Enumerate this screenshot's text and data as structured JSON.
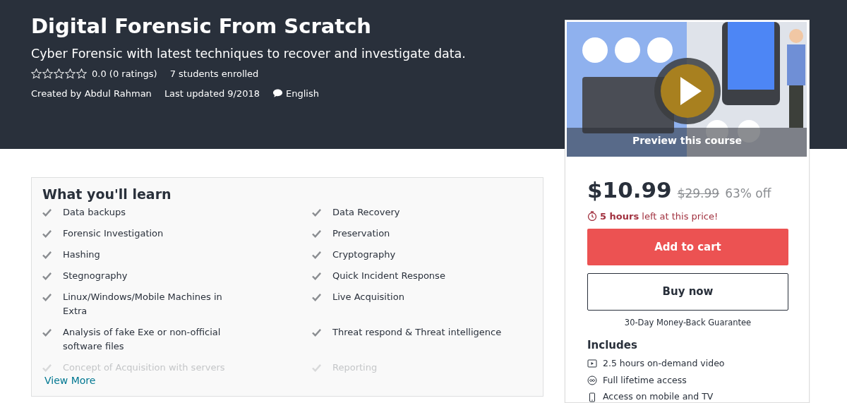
{
  "header": {
    "title": "Digital Forensic From Scratch",
    "subtitle": "Cyber Forensic with latest techniques to recover and investigate data.",
    "stars": 0,
    "rating": "0.0 (0 ratings)",
    "enrolled": "7 students enrolled",
    "author": "Created by Abdul Rahman",
    "updated": "Last updated 9/2018",
    "language": "English"
  },
  "learn": {
    "title": "What you'll learn",
    "items": [
      {
        "text": "Data backups",
        "faded": false
      },
      {
        "text": "Data Recovery",
        "faded": false
      },
      {
        "text": "Forensic Investigation",
        "faded": false
      },
      {
        "text": "Preservation",
        "faded": false
      },
      {
        "text": "Hashing",
        "faded": false
      },
      {
        "text": "Cryptography",
        "faded": false
      },
      {
        "text": "Stegnography",
        "faded": false
      },
      {
        "text": "Quick Incident Response",
        "faded": false
      },
      {
        "text": "Linux/Windows/Mobile Machines in Extra",
        "faded": false
      },
      {
        "text": "Live Acquisition",
        "faded": false
      },
      {
        "text": "Analysis of fake Exe or non-official software files",
        "faded": false
      },
      {
        "text": "Threat respond & Threat intelligence",
        "faded": false
      },
      {
        "text": "Concept of Acquisition with servers",
        "faded": true
      },
      {
        "text": "Reporting",
        "faded": true
      }
    ],
    "more_link": "View More"
  },
  "sidebar": {
    "preview_label": "Preview this course",
    "price": "$10.99",
    "original_price": "$29.99",
    "discount": "63% off",
    "timer_bold": "5 hours",
    "timer_rest": "left at this price!",
    "add_to_cart": "Add to cart",
    "buy_now": "Buy now",
    "guarantee": "30-Day Money-Back Guarantee",
    "includes_title": "Includes",
    "includes": [
      {
        "kind": "video",
        "text": "2.5 hours on-demand video"
      },
      {
        "kind": "lifetime",
        "text": "Full lifetime access"
      },
      {
        "kind": "mobile",
        "text": "Access on mobile and TV"
      }
    ]
  }
}
